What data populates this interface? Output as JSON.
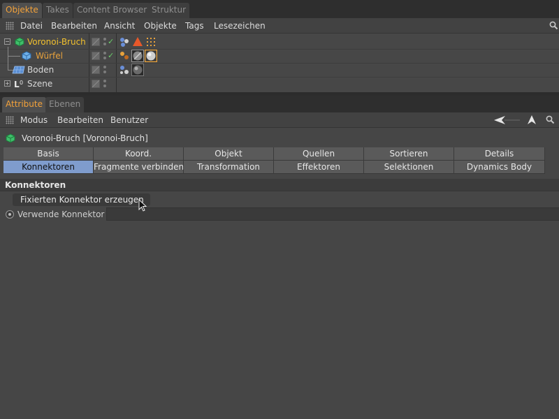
{
  "object_manager": {
    "tabs": [
      {
        "label": "Objekte",
        "active": true
      },
      {
        "label": "Takes",
        "active": false
      },
      {
        "label": "Content Browser",
        "active": false
      },
      {
        "label": "Struktur",
        "active": false
      }
    ],
    "menu": [
      "Datei",
      "Bearbeiten",
      "Ansicht",
      "Objekte",
      "Tags",
      "Lesezeichen"
    ],
    "objects": [
      {
        "name": "Voronoi-Bruch",
        "color": "#f2c12e",
        "icon": "voronoi-fracture-icon"
      },
      {
        "name": "Würfel",
        "color": "#e8a23c",
        "icon": "cube-icon"
      },
      {
        "name": "Boden",
        "color": "#d8d8d8",
        "icon": "floor-icon"
      },
      {
        "name": "Szene",
        "color": "#d8d8d8",
        "icon": "null-object-icon"
      }
    ]
  },
  "attribute_manager": {
    "tabs": [
      {
        "label": "Attribute",
        "active": true
      },
      {
        "label": "Ebenen",
        "active": false
      }
    ],
    "menu": [
      "Modus",
      "Bearbeiten",
      "Benutzer"
    ],
    "object_title": "Voronoi-Bruch [Voronoi-Bruch]",
    "page_tabs_row1": [
      "Basis",
      "Koord.",
      "Objekt",
      "Quellen",
      "Sortieren",
      "Details"
    ],
    "page_tabs_row2": [
      "Konnektoren",
      "Fragmente verbinden",
      "Transformation",
      "Effektoren",
      "Selektionen",
      "Dynamics Body"
    ],
    "active_page_tab": "Konnektoren",
    "section_title": "Konnektoren",
    "action_button": "Fixierten Konnektor erzeugen",
    "param_label": "Verwende Konnektor",
    "param_value": ""
  },
  "colors": {
    "accent_tab": "#f3a23a",
    "active_page": "#7f9ccd",
    "selected_object": "#f2c12e"
  }
}
